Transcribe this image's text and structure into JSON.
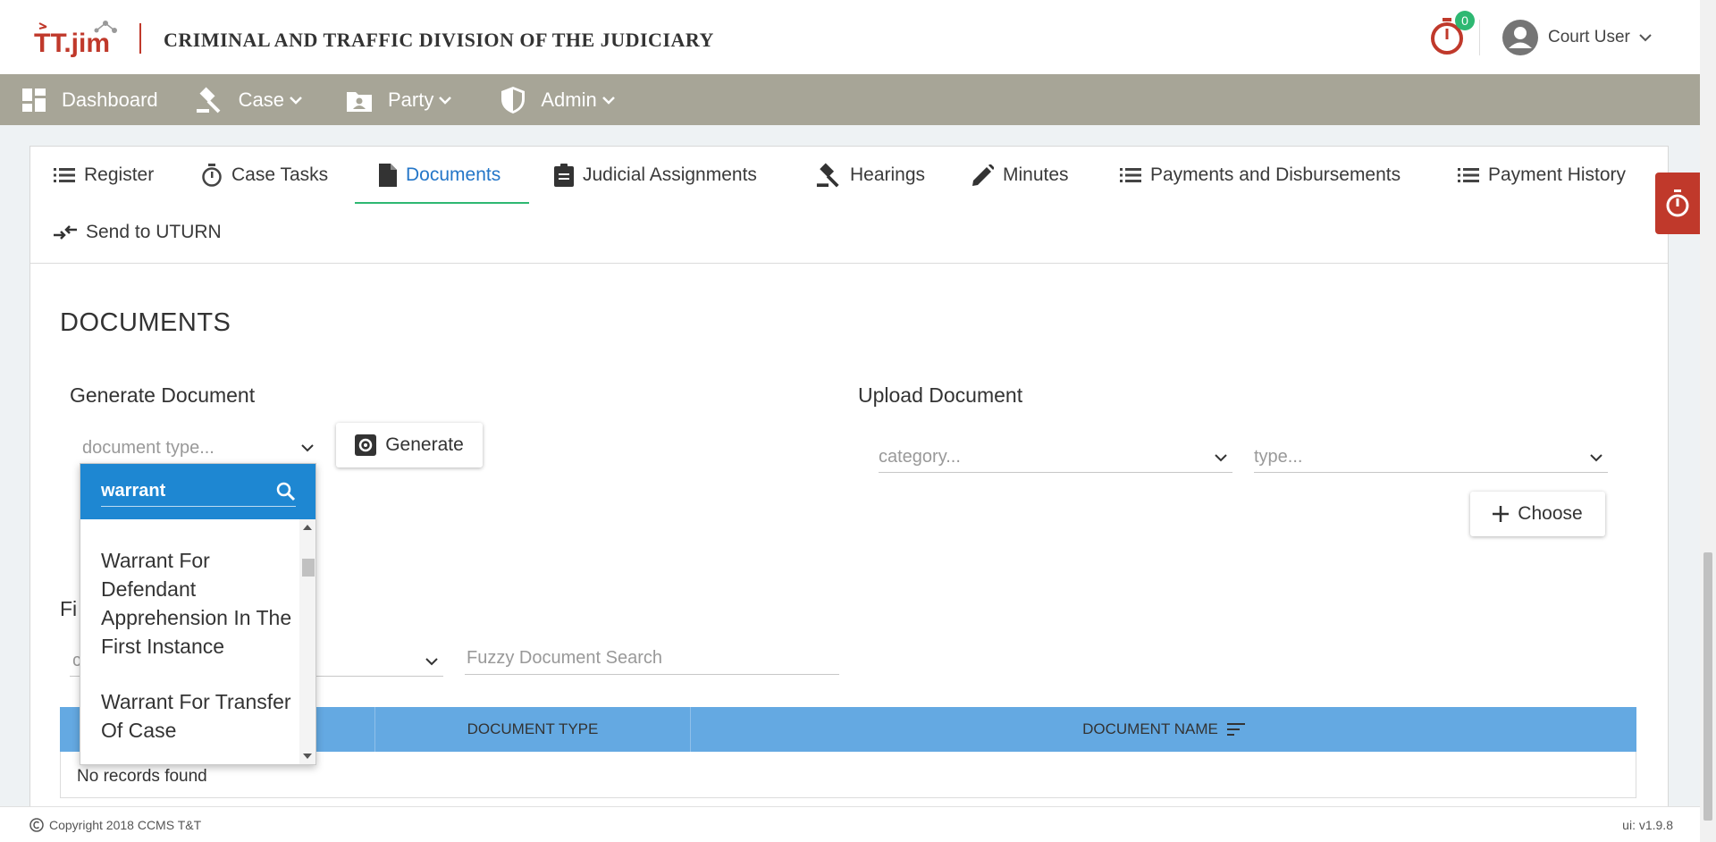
{
  "header": {
    "logo_text": "TT.jim",
    "title": "CRIMINAL AND TRAFFIC DIVISION OF THE JUDICIARY",
    "timer_badge": "0",
    "user_name": "Court User"
  },
  "nav": {
    "items": [
      {
        "label": "Dashboard",
        "icon": "dashboard-icon",
        "has_menu": false
      },
      {
        "label": "Case",
        "icon": "gavel-icon",
        "has_menu": true
      },
      {
        "label": "Party",
        "icon": "contact-icon",
        "has_menu": true
      },
      {
        "label": "Admin",
        "icon": "shield-icon",
        "has_menu": true
      }
    ]
  },
  "tabs": [
    {
      "label": "Register",
      "icon": "list-icon"
    },
    {
      "label": "Case Tasks",
      "icon": "timer-icon"
    },
    {
      "label": "Documents",
      "icon": "document-icon",
      "active": true
    },
    {
      "label": "Judicial Assignments",
      "icon": "clipboard-icon"
    },
    {
      "label": "Hearings",
      "icon": "gavel-icon"
    },
    {
      "label": "Minutes",
      "icon": "pencil-icon"
    },
    {
      "label": "Payments and Disbursements",
      "icon": "list-icon"
    },
    {
      "label": "Payment History",
      "icon": "list-icon"
    },
    {
      "label": "Send to UTURN",
      "icon": "transfer-icon"
    }
  ],
  "documents": {
    "section_title": "DOCUMENTS",
    "generate": {
      "title": "Generate Document",
      "type_placeholder": "document type...",
      "button_label": "Generate"
    },
    "upload": {
      "title": "Upload Document",
      "category_placeholder": "category...",
      "type_placeholder": "type...",
      "button_label": "Choose"
    },
    "filter": {
      "label_visible": "Fi",
      "select_visible": "c",
      "fuzzy_placeholder": "Fuzzy Document Search"
    },
    "table": {
      "columns": [
        "",
        "DOCUMENT TYPE",
        "DOCUMENT NAME"
      ],
      "empty_text": "No records found"
    }
  },
  "dropdown_panel": {
    "search_value": "warrant",
    "options": [
      "Warrant For Defendant Apprehension In The First Instance",
      "Warrant For Transfer Of Case"
    ]
  },
  "footer": {
    "copyright": "Copyright 2018  CCMS T&T",
    "version": "ui: v1.9.8"
  },
  "colors": {
    "navbar": "#a7a597",
    "accent_blue": "#2476c8",
    "active_underline": "#2eb872",
    "table_header": "#64a9e2",
    "panel_header": "#1e87d2",
    "timer_red": "#c0392b"
  }
}
